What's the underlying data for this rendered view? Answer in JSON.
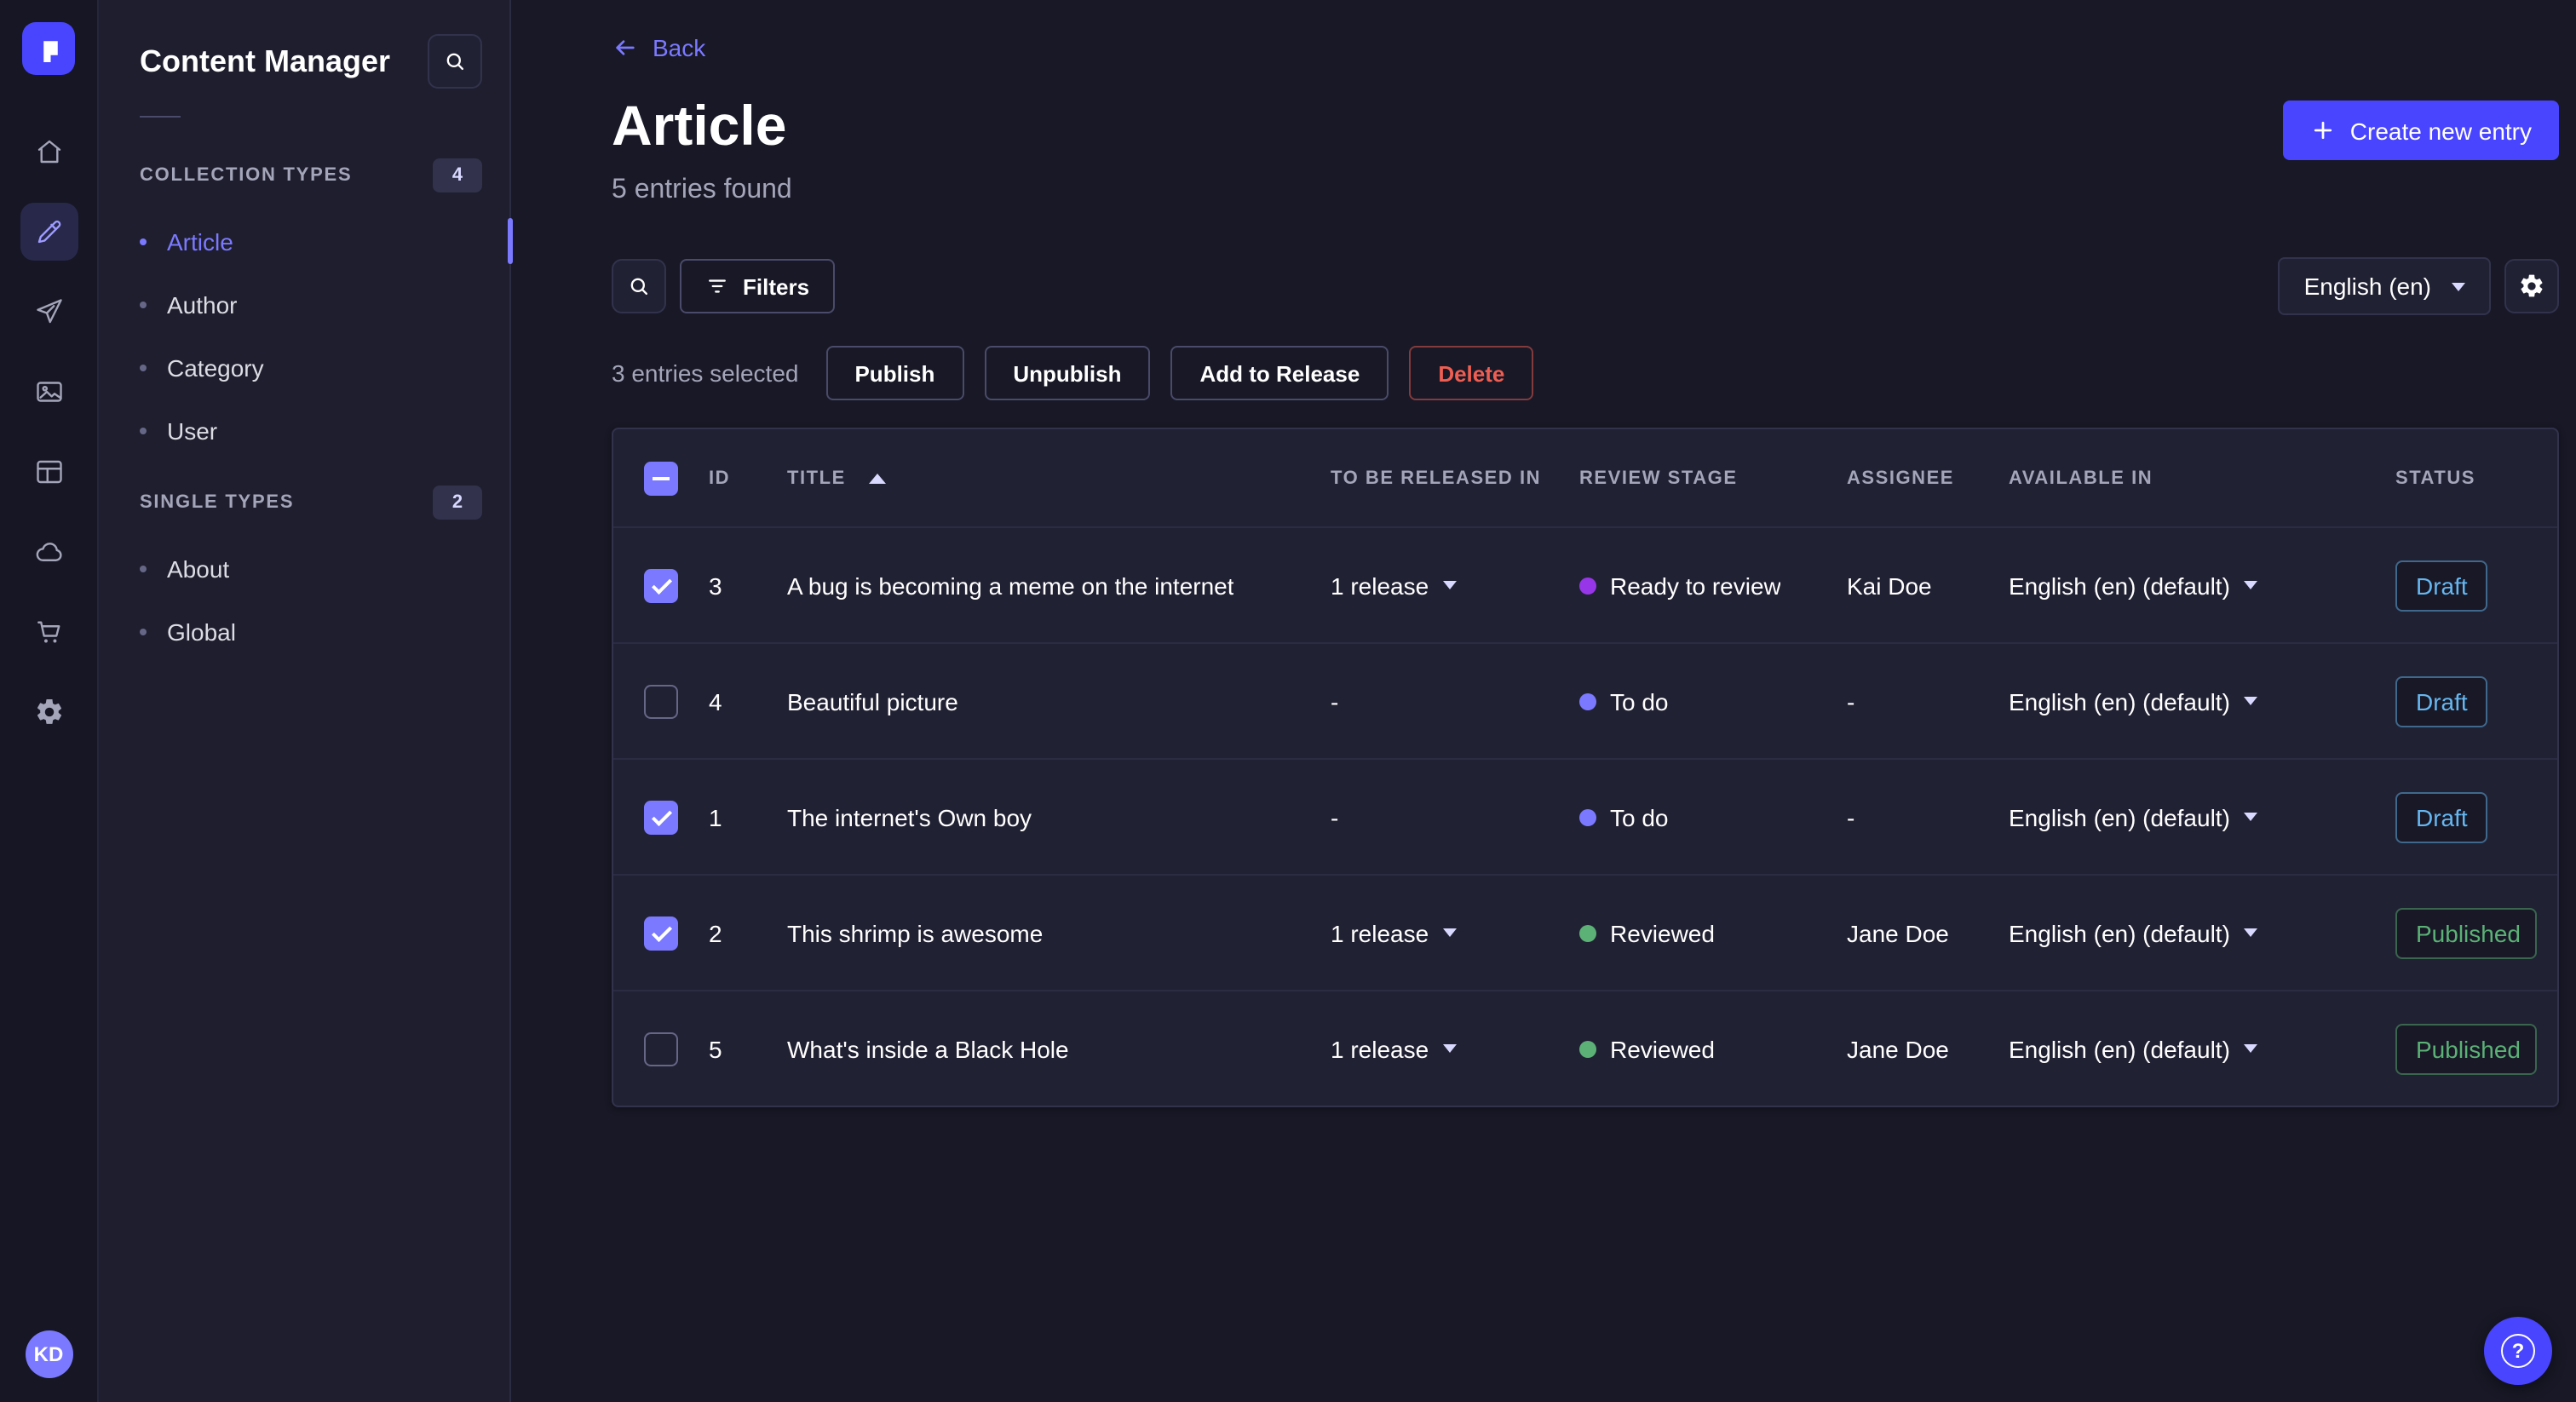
{
  "app": {
    "name": "Strapi",
    "avatar_initials": "KD",
    "nav_icons": [
      "strapi-logo",
      "home",
      "content-manager",
      "releases",
      "media-library",
      "content-type-builder",
      "cloud",
      "marketplace",
      "settings"
    ],
    "active_nav": "content-manager"
  },
  "sidebar": {
    "title": "Content Manager",
    "search_icon": "search-icon",
    "sections": [
      {
        "label": "COLLECTION TYPES",
        "badge": "4",
        "items": [
          {
            "label": "Article",
            "active": "true"
          },
          {
            "label": "Author",
            "active": "false"
          },
          {
            "label": "Category",
            "active": "false"
          },
          {
            "label": "User",
            "active": "false"
          }
        ]
      },
      {
        "label": "SINGLE TYPES",
        "badge": "2",
        "items": [
          {
            "label": "About",
            "active": "false"
          },
          {
            "label": "Global",
            "active": "false"
          }
        ]
      }
    ]
  },
  "header": {
    "back_label": "Back",
    "title": "Article",
    "subtitle": "5 entries found",
    "create_button_label": "Create new entry"
  },
  "toolbar": {
    "filters_label": "Filters",
    "locale_selected": "English (en)"
  },
  "selection": {
    "summary": "3 entries selected",
    "actions": [
      {
        "label": "Publish",
        "variant": "default"
      },
      {
        "label": "Unpublish",
        "variant": "default"
      },
      {
        "label": "Add to Release",
        "variant": "default"
      },
      {
        "label": "Delete",
        "variant": "danger"
      }
    ]
  },
  "table": {
    "columns": [
      "ID",
      "TITLE",
      "TO BE RELEASED IN",
      "REVIEW STAGE",
      "ASSIGNEE",
      "AVAILABLE IN",
      "STATUS"
    ],
    "sort": {
      "column": "TITLE",
      "direction": "asc"
    },
    "header_checkbox": "indeterminate",
    "rows": [
      {
        "checked": "true",
        "id": "3",
        "title": "A bug is becoming a meme on the internet",
        "release": "1 release",
        "release_expandable": "true",
        "review_stage": "Ready to review",
        "stage_type": "ready",
        "assignee": "Kai Doe",
        "available_in": "English (en) (default)",
        "status": "Draft",
        "status_type": "draft"
      },
      {
        "checked": "false",
        "id": "4",
        "title": "Beautiful picture",
        "release": "-",
        "release_expandable": "false",
        "review_stage": "To do",
        "stage_type": "todo",
        "assignee": "-",
        "available_in": "English (en) (default)",
        "status": "Draft",
        "status_type": "draft"
      },
      {
        "checked": "true",
        "id": "1",
        "title": "The internet's Own boy",
        "release": "-",
        "release_expandable": "false",
        "review_stage": "To do",
        "stage_type": "todo",
        "assignee": "-",
        "available_in": "English (en) (default)",
        "status": "Draft",
        "status_type": "draft"
      },
      {
        "checked": "true",
        "id": "2",
        "title": "This shrimp is awesome",
        "release": "1 release",
        "release_expandable": "true",
        "review_stage": "Reviewed",
        "stage_type": "reviewed",
        "assignee": "Jane Doe",
        "available_in": "English (en) (default)",
        "status": "Published",
        "status_type": "published"
      },
      {
        "checked": "false",
        "id": "5",
        "title": "What's inside a Black Hole",
        "release": "1 release",
        "release_expandable": "true",
        "review_stage": "Reviewed",
        "stage_type": "reviewed",
        "assignee": "Jane Doe",
        "available_in": "English (en) (default)",
        "status": "Published",
        "status_type": "published"
      }
    ]
  },
  "colors": {
    "primary": "#4945ff",
    "primary_light": "#7b79ff",
    "danger": "#ee5e52",
    "published_green": "#5cb176",
    "draft_blue": "#66b7f1",
    "stage_ready": "#9736e8",
    "stage_todo": "#7b79ff",
    "stage_reviewed": "#5cb176"
  },
  "help": {
    "icon": "?"
  }
}
